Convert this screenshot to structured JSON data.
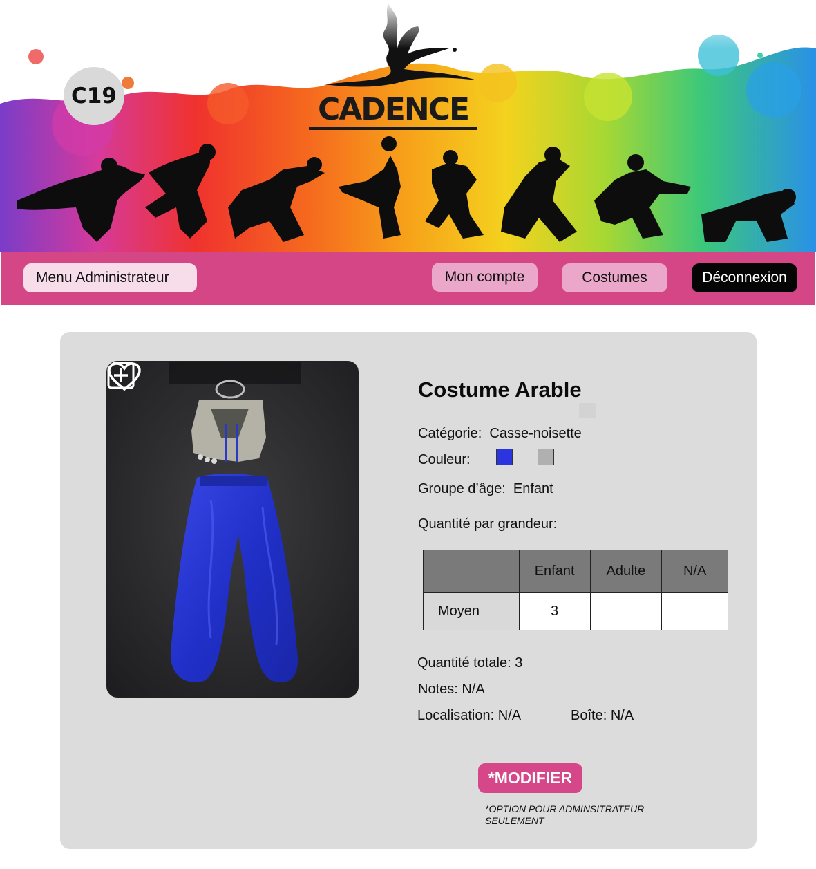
{
  "header": {
    "badge": "C19",
    "brand": "CADENCE"
  },
  "nav": {
    "admin_menu": "Menu Administrateur",
    "my_account": "Mon compte",
    "costumes": "Costumes",
    "logout": "Déconnexion"
  },
  "costume": {
    "title": "Costume Arable",
    "category_label": "Catégorie:",
    "category_value": "Casse-noisette",
    "color_label": "Couleur:",
    "colors": [
      "#2a35e0",
      "#b0b0b0"
    ],
    "age_group_label": "Groupe d’âge:",
    "age_group_value": "Enfant",
    "quantity_by_size_label": "Quantité par grandeur:",
    "size_table": {
      "columns": [
        "",
        "Enfant",
        "Adulte",
        "N/A"
      ],
      "rows": [
        {
          "label": "Moyen",
          "values": [
            "3",
            "",
            ""
          ]
        }
      ]
    },
    "total_quantity": "Quantité totale: 3",
    "notes": "Notes: N/A",
    "location": "Localisation: N/A",
    "box": "Boîte: N/A"
  },
  "actions": {
    "modify": "*MODIFIER",
    "admin_note": "*OPTION POUR ADMINSITRATEUR SEULEMENT"
  },
  "icons": {
    "add": "plus-square-icon",
    "favorite": "heart-icon"
  }
}
